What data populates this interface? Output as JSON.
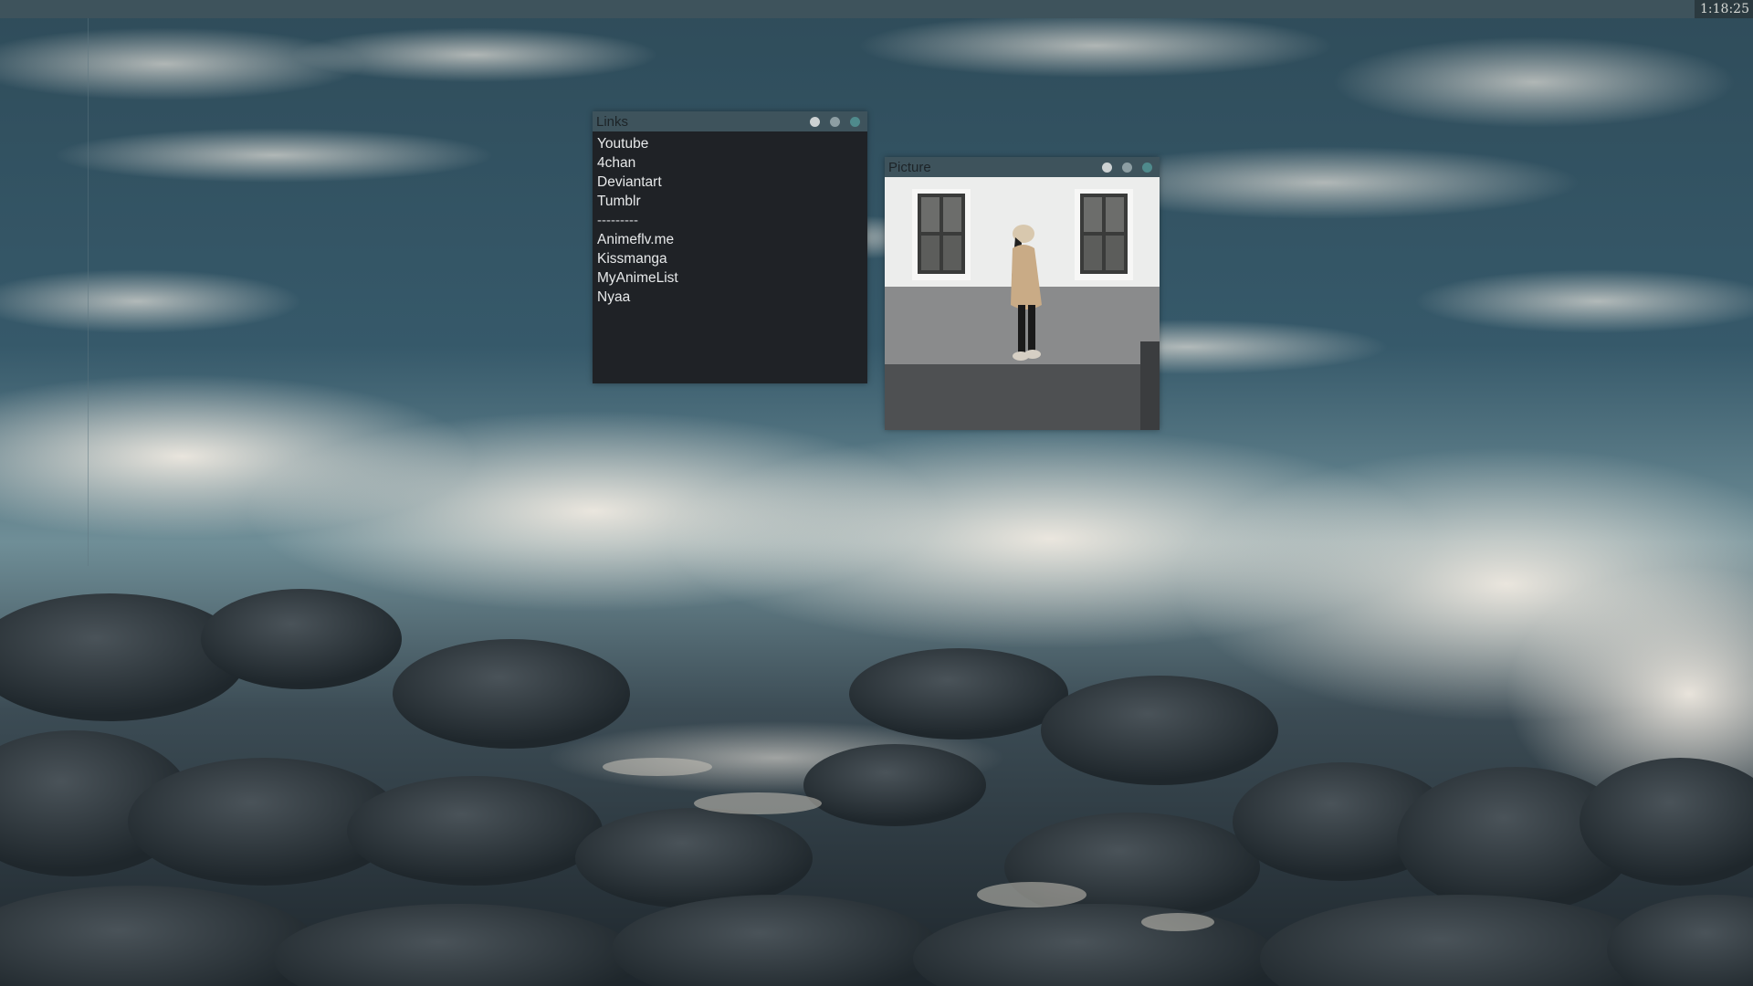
{
  "topbar": {
    "clock": "1:18:25"
  },
  "windows": {
    "links": {
      "title": "Links",
      "items": [
        "Youtube",
        "4chan",
        "Deviantart",
        "Tumblr"
      ],
      "separator": "---------",
      "items2": [
        "Animeflv.me",
        "Kissmanga",
        "MyAnimeList",
        "Nyaa"
      ]
    },
    "picture": {
      "title": "Picture"
    }
  },
  "colors": {
    "titlebar": "#3e535c",
    "panel": "#1f2226",
    "dot_light": "#cdd2d3",
    "dot_mid": "#8d9ea3",
    "dot_teal": "#4f8a8c"
  },
  "icons": [
    "minimize-dot-icon",
    "maximize-dot-icon",
    "close-dot-icon"
  ]
}
